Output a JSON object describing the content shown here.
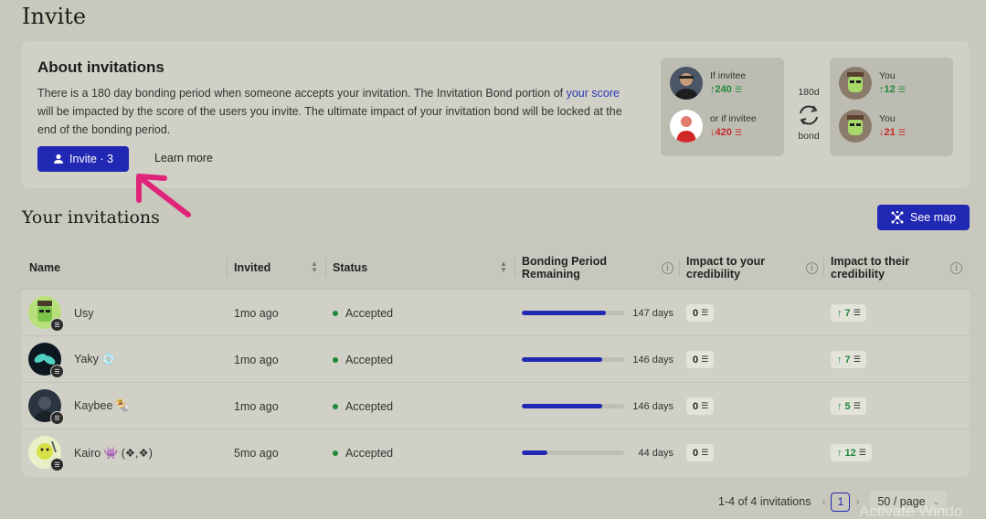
{
  "page": {
    "title": "Invite"
  },
  "about": {
    "title": "About invitations",
    "text_before": "There is a 180 day bonding period when someone accepts your invitation. The Invitation Bond portion of ",
    "text_link": "your score",
    "text_after": " will be impacted by the score of the users you invite. The ultimate impact of your invitation bond will be locked at the end of the bonding period.",
    "invite_button": "Invite · 3",
    "learn_more": "Learn more"
  },
  "bond": {
    "left": {
      "top_label": "If invitee",
      "top_value": "↑240",
      "bottom_label": "or if invitee",
      "bottom_value": "↓420"
    },
    "middle": {
      "top": "180d",
      "bottom": "bond"
    },
    "right": {
      "top_label": "You",
      "top_value": "↑12",
      "bottom_label": "You",
      "bottom_value": "↓21"
    }
  },
  "section": {
    "title": "Your invitations",
    "see_map": "See map"
  },
  "table": {
    "headers": {
      "name": "Name",
      "invited": "Invited",
      "status": "Status",
      "bonding": "Bonding Period Remaining",
      "impact_yours": "Impact to your credibility",
      "impact_theirs": "Impact to their credibility"
    },
    "rows": [
      {
        "name": "Usy",
        "invited": "1mo ago",
        "status": "Accepted",
        "progress": 0.82,
        "days": "147 days",
        "impact_yours": "0",
        "impact_theirs": "↑ 7"
      },
      {
        "name": "Yaky 💿",
        "invited": "1mo ago",
        "status": "Accepted",
        "progress": 0.79,
        "days": "146 days",
        "impact_yours": "0",
        "impact_theirs": "↑ 7"
      },
      {
        "name": "Kaybee 🌯",
        "invited": "1mo ago",
        "status": "Accepted",
        "progress": 0.79,
        "days": "146 days",
        "impact_yours": "0",
        "impact_theirs": "↑ 5"
      },
      {
        "name": "Kairo 👾 (❖,❖)",
        "invited": "5mo ago",
        "status": "Accepted",
        "progress": 0.25,
        "days": "44 days",
        "impact_yours": "0",
        "impact_theirs": "↑ 12"
      }
    ]
  },
  "pagination": {
    "summary": "1-4 of 4 invitations",
    "page": "1",
    "page_size": "50 / page"
  },
  "watermark": "Activate Windo",
  "icons": {
    "score": "score-icon",
    "invite": "user-plus-icon",
    "map": "network-icon",
    "refresh": "refresh-icon",
    "info": "info-icon",
    "sort": "sort-icon"
  },
  "colors": {
    "accent": "#2128b3",
    "positive": "#1f8a3a",
    "negative": "#c62828",
    "annotation": "#e0247a"
  }
}
